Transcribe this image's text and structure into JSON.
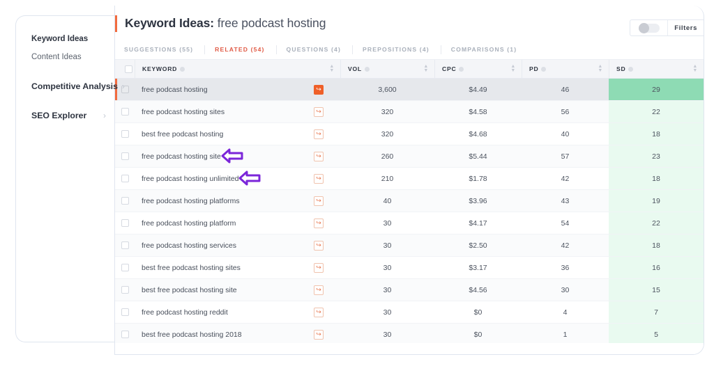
{
  "sidebar": {
    "items": [
      {
        "label": "Keyword Ideas",
        "type": "active-sub",
        "chevron": ""
      },
      {
        "label": "Content Ideas",
        "type": "sub",
        "chevron": ""
      },
      {
        "label": "Competitive Analysis",
        "type": "primary",
        "chevron": "›"
      },
      {
        "label": "SEO Explorer",
        "type": "primary",
        "chevron": "›"
      }
    ]
  },
  "header": {
    "title_prefix": "Keyword Ideas:",
    "title_query": "free podcast hosting",
    "filters_label": "Filters",
    "toggle_state": "off"
  },
  "tabs": [
    {
      "label": "SUGGESTIONS (55)",
      "active": false
    },
    {
      "label": "RELATED (54)",
      "active": true
    },
    {
      "label": "QUESTIONS (4)",
      "active": false
    },
    {
      "label": "PREPOSITIONS (4)",
      "active": false
    },
    {
      "label": "COMPARISONS (1)",
      "active": false
    }
  ],
  "table": {
    "columns": [
      {
        "key": "keyword",
        "label": "KEYWORD"
      },
      {
        "key": "vol",
        "label": "VOL"
      },
      {
        "key": "cpc",
        "label": "CPC"
      },
      {
        "key": "pd",
        "label": "PD"
      },
      {
        "key": "sd",
        "label": "SD"
      }
    ],
    "rows": [
      {
        "keyword": "free podcast hosting",
        "vol": "3,600",
        "cpc": "$4.49",
        "pd": "46",
        "sd": "29",
        "selected": true
      },
      {
        "keyword": "free podcast hosting sites",
        "vol": "320",
        "cpc": "$4.58",
        "pd": "56",
        "sd": "22",
        "selected": false
      },
      {
        "keyword": "best free podcast hosting",
        "vol": "320",
        "cpc": "$4.68",
        "pd": "40",
        "sd": "18",
        "selected": false
      },
      {
        "keyword": "free podcast hosting site",
        "vol": "260",
        "cpc": "$5.44",
        "pd": "57",
        "sd": "23",
        "selected": false
      },
      {
        "keyword": "free podcast hosting unlimited",
        "vol": "210",
        "cpc": "$1.78",
        "pd": "42",
        "sd": "18",
        "selected": false
      },
      {
        "keyword": "free podcast hosting platforms",
        "vol": "40",
        "cpc": "$3.96",
        "pd": "43",
        "sd": "19",
        "selected": false
      },
      {
        "keyword": "free podcast hosting platform",
        "vol": "30",
        "cpc": "$4.17",
        "pd": "54",
        "sd": "22",
        "selected": false
      },
      {
        "keyword": "free podcast hosting services",
        "vol": "30",
        "cpc": "$2.50",
        "pd": "42",
        "sd": "18",
        "selected": false
      },
      {
        "keyword": "best free podcast hosting sites",
        "vol": "30",
        "cpc": "$3.17",
        "pd": "36",
        "sd": "16",
        "selected": false
      },
      {
        "keyword": "best free podcast hosting site",
        "vol": "30",
        "cpc": "$4.56",
        "pd": "30",
        "sd": "15",
        "selected": false
      },
      {
        "keyword": "free podcast hosting reddit",
        "vol": "30",
        "cpc": "$0",
        "pd": "4",
        "sd": "7",
        "selected": false
      },
      {
        "keyword": "best free podcast hosting 2018",
        "vol": "30",
        "cpc": "$0",
        "pd": "1",
        "sd": "5",
        "selected": false
      }
    ]
  },
  "annotations": [
    {
      "name": "arrow-pointing-row-4",
      "target_row": 3
    },
    {
      "name": "arrow-pointing-row-5",
      "target_row": 4
    }
  ],
  "colors": {
    "accent_orange": "#f26b3f",
    "tab_active_red": "#e05a45",
    "sd_highlight_green": "#8edbb4",
    "sd_column_green": "#e9faf0",
    "annotation_purple": "#7b26d9"
  }
}
